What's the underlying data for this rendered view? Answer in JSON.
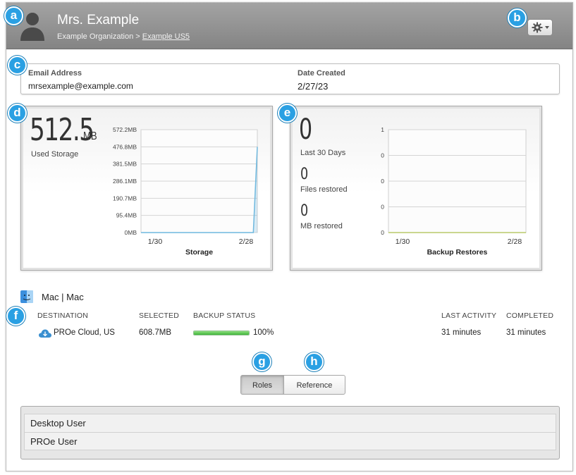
{
  "header": {
    "user_name": "Mrs. Example",
    "org": "Example Organization",
    "separator": ">",
    "org_link": "Example US5"
  },
  "badges": {
    "a": "a",
    "b": "b",
    "c": "c",
    "d": "d",
    "e": "e",
    "f": "f",
    "g": "g",
    "h": "h"
  },
  "icons": {
    "avatar": "user-silhouette-icon",
    "settings": "gear-icon",
    "device": "mac-finder-icon",
    "destination": "cloud-icon"
  },
  "info": {
    "email_label": "Email Address",
    "email_value": "mrsexample@example.com",
    "date_label": "Date Created",
    "date_value": "2/27/23"
  },
  "storage": {
    "value": "512.5",
    "unit": "MB",
    "label": "Used Storage"
  },
  "restores": {
    "last30_value": "0",
    "last30_label": "Last 30 Days",
    "files_value": "0",
    "files_label": "Files restored",
    "mb_value": "0",
    "mb_label": "MB restored"
  },
  "chart_data": [
    {
      "type": "area",
      "title": "Storage",
      "yticks": [
        "572.2MB",
        "476.8MB",
        "381.5MB",
        "286.1MB",
        "190.7MB",
        "95.4MB",
        "0MB"
      ],
      "ylim": [
        0,
        572.2
      ],
      "xticks": [
        "1/30",
        "2/28"
      ],
      "x": [
        0,
        28,
        29
      ],
      "values": [
        0,
        0,
        476.8
      ],
      "color": "#6fb8de",
      "grid": true
    },
    {
      "type": "area",
      "title": "Backup Restores",
      "yticks": [
        "1",
        "0",
        "0",
        "0",
        "0"
      ],
      "ylim": [
        0,
        1
      ],
      "xticks": [
        "1/30",
        "2/28"
      ],
      "x": [
        0,
        29
      ],
      "values": [
        0,
        0
      ],
      "color": "#b9c96a",
      "grid": true
    }
  ],
  "device": {
    "name": "Mac | Mac"
  },
  "table": {
    "headers": {
      "destination": "DESTINATION",
      "selected": "SELECTED",
      "backup_status": "BACKUP STATUS",
      "last_activity": "LAST ACTIVITY",
      "completed": "COMPLETED"
    },
    "row": {
      "destination": "PROe Cloud, US",
      "selected": "608.7MB",
      "progress": 100,
      "progress_label": "100%",
      "last_activity": "31 minutes",
      "completed": "31 minutes"
    }
  },
  "tabs": {
    "roles": "Roles",
    "reference": "Reference"
  },
  "roles": [
    "Desktop User",
    "PROe User"
  ]
}
